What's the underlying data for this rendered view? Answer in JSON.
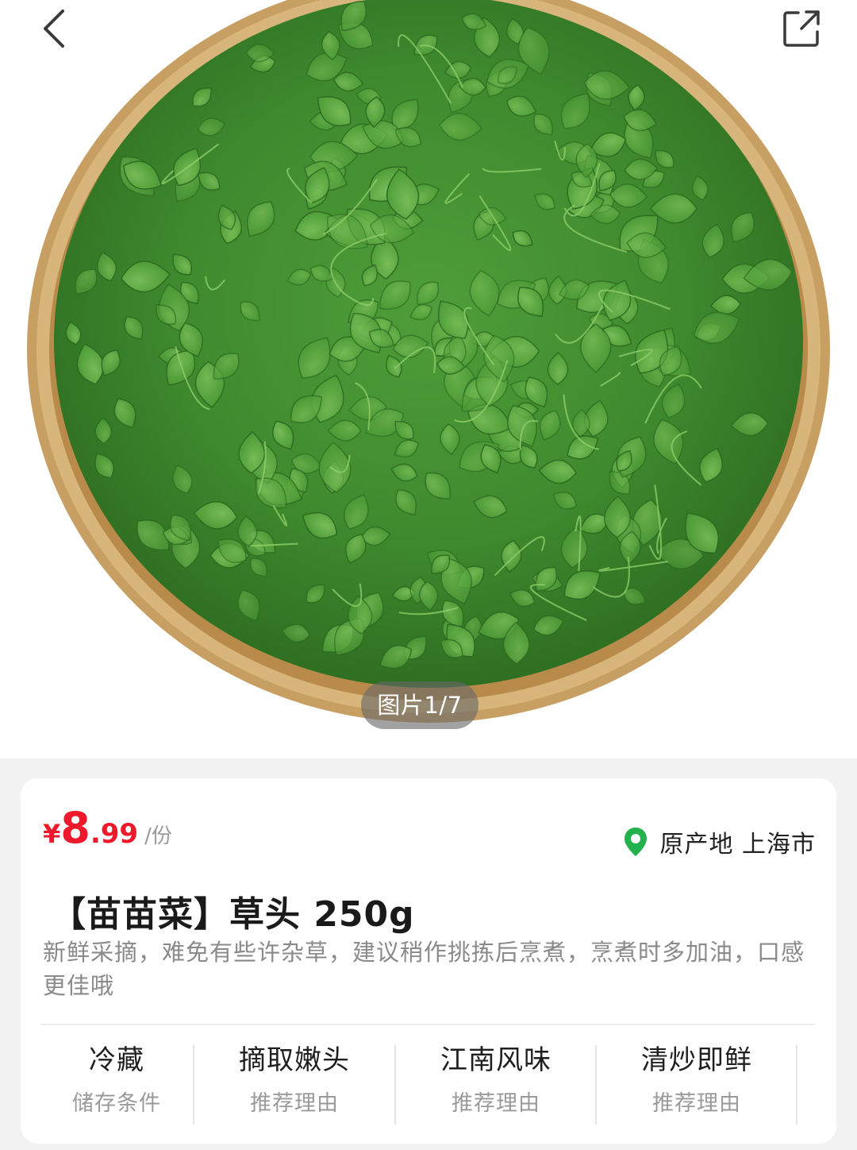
{
  "nav": {
    "back_icon": "chevron-left-icon",
    "share_icon": "share-external-icon"
  },
  "gallery": {
    "counter": "图片1/7"
  },
  "product": {
    "price_currency": "¥",
    "price_int": "8",
    "price_dec": ".99",
    "price_unit": "/份",
    "price_color": "#ee1a2b",
    "origin_icon": "location-pin-icon",
    "origin_color": "#22b14c",
    "origin_text": "原产地 上海市",
    "title": "【苗苗菜】草头 250g",
    "description": "新鲜采摘，难免有些许杂草，建议稍作挑拣后烹煮，烹煮时多加油，口感更佳哦"
  },
  "features": [
    {
      "title": "冷藏",
      "subtitle": "储存条件"
    },
    {
      "title": "摘取嫩头",
      "subtitle": "推荐理由"
    },
    {
      "title": "江南风味",
      "subtitle": "推荐理由"
    },
    {
      "title": "清炒即鲜",
      "subtitle": "推荐理由"
    }
  ]
}
